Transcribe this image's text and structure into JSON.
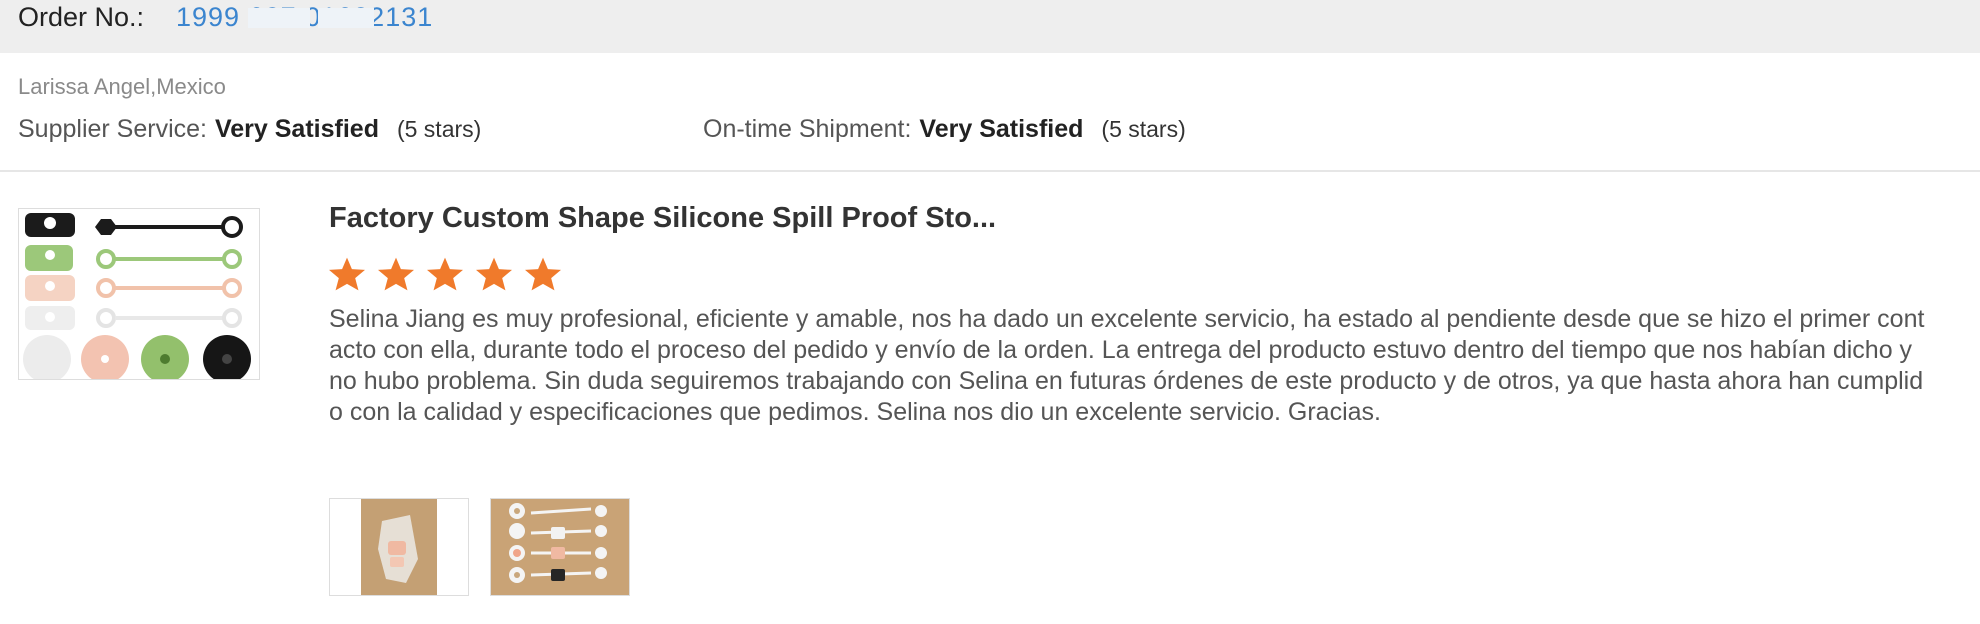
{
  "order": {
    "label": "Order No.:",
    "number": "1999      627      01622131"
  },
  "buyer": {
    "name_location": "Larissa Angel,Mexico"
  },
  "ratings": [
    {
      "label": "Supplier Service:",
      "value": "Very Satisfied",
      "stars_text": "(5 stars)"
    },
    {
      "label": "On-time Shipment:",
      "value": "Very Satisfied",
      "stars_text": "(5 stars)"
    }
  ],
  "product": {
    "title": "Factory Custom Shape Silicone Spill Proof Sto...",
    "rating_stars": 5
  },
  "review": {
    "text": "Selina Jiang es muy profesional, eficiente y amable, nos ha dado un excelente servicio, ha estado al pendiente desde que se hizo el primer contacto con ella, durante todo el proceso del pedido y envío de la orden. La entrega del producto estuvo dentro del tiempo que nos habían dicho y no hubo problema. Sin duda seguiremos trabajando con Selina en futuras órdenes de este producto y de otros, ya que hasta ahora han cumplido con la calidad y especificaciones que pedimos. Selina nos dio un excelente servicio. Gracias."
  },
  "colors": {
    "order_link": "#3b85cf",
    "star": "#f07a2b",
    "header_bg": "#eeeeee"
  }
}
